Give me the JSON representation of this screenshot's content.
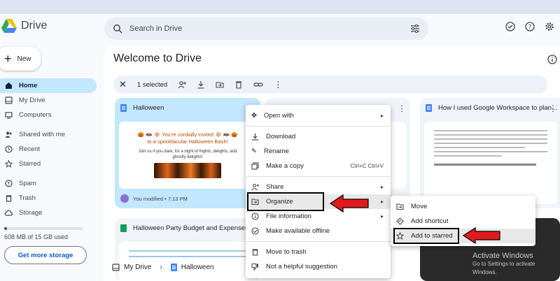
{
  "app": {
    "name": "Drive"
  },
  "search": {
    "placeholder": "Search in Drive"
  },
  "new_button": {
    "label": "New"
  },
  "sidebar": {
    "items": [
      {
        "label": "Home",
        "icon": "home-icon"
      },
      {
        "label": "My Drive",
        "icon": "my-drive-icon"
      },
      {
        "label": "Computers",
        "icon": "computers-icon"
      },
      {
        "label": "Shared with me",
        "icon": "shared-icon"
      },
      {
        "label": "Recent",
        "icon": "clock-icon"
      },
      {
        "label": "Starred",
        "icon": "star-icon"
      },
      {
        "label": "Spam",
        "icon": "spam-icon"
      },
      {
        "label": "Trash",
        "icon": "trash-icon"
      },
      {
        "label": "Storage",
        "icon": "cloud-icon"
      }
    ]
  },
  "storage": {
    "text": "608 MB of 15 GB used",
    "used_fraction": 0.04,
    "button": "Get more storage"
  },
  "main": {
    "title": "Welcome to Drive"
  },
  "selection_bar": {
    "count": "1 selected"
  },
  "cards": [
    {
      "title": "Halloween",
      "invite_line1": "🎃 🦇 🕸 You're cordially invited 🕸 🦇 🎃",
      "invite_line2": "to a spooktacular Halloween Bash!",
      "body": "Join us if you dare, for a night of frights, delights, and ghostly delights!",
      "footer": "You modified • 7:13 PM"
    },
    {
      "title": "How I used Google Workspace to plan..."
    },
    {
      "title": "Halloween Party Budget and Expenses"
    }
  ],
  "context_menu": {
    "open_with": "Open with",
    "download": "Download",
    "rename": "Rename",
    "make_copy": "Make a copy",
    "make_copy_shortcut": "Ctrl+C Ctrl+V",
    "share": "Share",
    "organize": "Organize",
    "file_info": "File information",
    "offline": "Make available offline",
    "trash": "Move to trash",
    "not_helpful": "Not a helpful suggestion"
  },
  "submenu": {
    "move": "Move",
    "add_shortcut": "Add shortcut",
    "add_starred": "Add to starred"
  },
  "breadcrumb": {
    "root": "My Drive",
    "current": "Halloween"
  },
  "watermark": {
    "line1": "Activate Windows",
    "line2": "Go to Settings to activate Windows."
  },
  "colors": {
    "accent": "#0b57d0",
    "selected": "#c2e7ff",
    "arrow": "#e01b1b"
  }
}
